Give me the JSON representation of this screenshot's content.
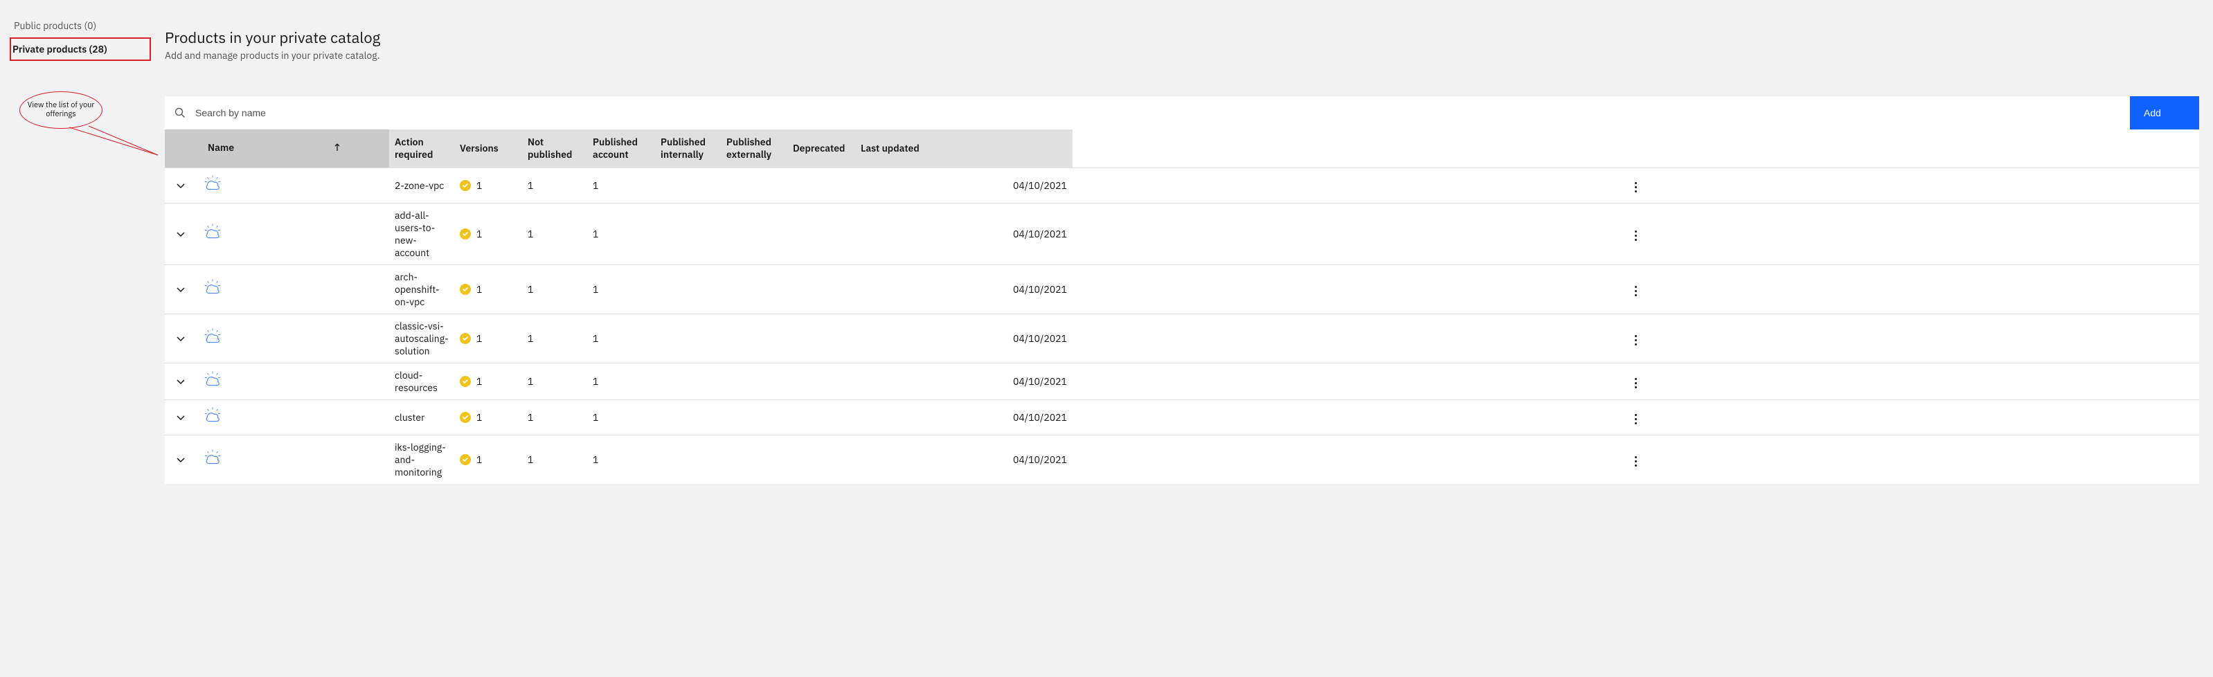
{
  "sidebar": {
    "items": [
      {
        "label": "Public products (0)",
        "selected": false
      },
      {
        "label": "Private products (28)",
        "selected": true
      }
    ]
  },
  "callout": {
    "text": "View the list of your offerings"
  },
  "header": {
    "title": "Products in your private catalog",
    "subtitle": "Add and manage products in your private catalog."
  },
  "toolbar": {
    "search_placeholder": "Search by name",
    "add_label": "Add"
  },
  "table": {
    "columns": {
      "name": "Name",
      "action_required": "Action required",
      "versions": "Versions",
      "not_published": "Not published",
      "published_account": "Published account",
      "published_internally": "Published internally",
      "published_externally": "Published externally",
      "deprecated": "Deprecated",
      "last_updated": "Last updated"
    },
    "rows": [
      {
        "name": "2-zone-vpc",
        "action_required": "1",
        "versions": "1",
        "not_published": "1",
        "published_account": "",
        "published_internally": "",
        "published_externally": "",
        "deprecated": "",
        "last_updated": "04/10/2021"
      },
      {
        "name": "add-all-users-to-new-account",
        "action_required": "1",
        "versions": "1",
        "not_published": "1",
        "published_account": "",
        "published_internally": "",
        "published_externally": "",
        "deprecated": "",
        "last_updated": "04/10/2021"
      },
      {
        "name": "arch-openshift-on-vpc",
        "action_required": "1",
        "versions": "1",
        "not_published": "1",
        "published_account": "",
        "published_internally": "",
        "published_externally": "",
        "deprecated": "",
        "last_updated": "04/10/2021"
      },
      {
        "name": "classic-vsi-autoscaling-solution",
        "action_required": "1",
        "versions": "1",
        "not_published": "1",
        "published_account": "",
        "published_internally": "",
        "published_externally": "",
        "deprecated": "",
        "last_updated": "04/10/2021"
      },
      {
        "name": "cloud-resources",
        "action_required": "1",
        "versions": "1",
        "not_published": "1",
        "published_account": "",
        "published_internally": "",
        "published_externally": "",
        "deprecated": "",
        "last_updated": "04/10/2021"
      },
      {
        "name": "cluster",
        "action_required": "1",
        "versions": "1",
        "not_published": "1",
        "published_account": "",
        "published_internally": "",
        "published_externally": "",
        "deprecated": "",
        "last_updated": "04/10/2021"
      },
      {
        "name": "iks-logging-and-monitoring",
        "action_required": "1",
        "versions": "1",
        "not_published": "1",
        "published_account": "",
        "published_internally": "",
        "published_externally": "",
        "deprecated": "",
        "last_updated": "04/10/2021"
      }
    ]
  }
}
